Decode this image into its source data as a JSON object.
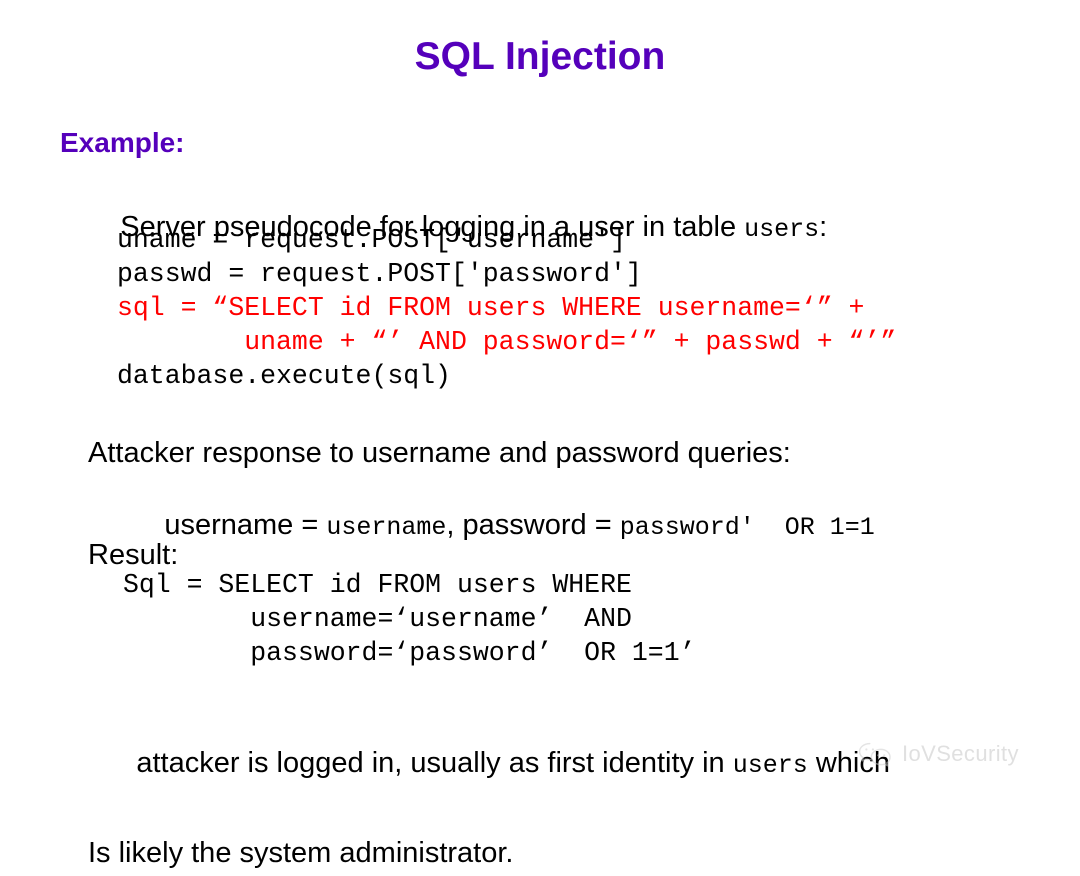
{
  "slide": {
    "title": "SQL Injection",
    "title_color": "#5500bb",
    "background_color": "#ffffff",
    "code_accent_color": "#ff0000"
  },
  "example": {
    "heading": "Example:",
    "lead_text_before": "Server pseudocode for logging in a user in table ",
    "lead_code": "users",
    "lead_text_after": ":"
  },
  "pseudocode": {
    "lines": [
      {
        "text": "uname = request.POST['username']",
        "color": "black"
      },
      {
        "text": "passwd = request.POST['password']",
        "color": "black"
      },
      {
        "text": "sql = “SELECT id FROM users WHERE username=‘” +",
        "color": "red"
      },
      {
        "text": "        uname + “’ AND password=‘” + passwd + “’”",
        "color": "red"
      },
      {
        "text": "database.execute(sql)",
        "color": "black"
      }
    ]
  },
  "attacker": {
    "intro": "Attacker response to username and password queries:",
    "field1_label": "username",
    "field1_equals": " = ",
    "field1_value": "username",
    "separator": ", ",
    "field2_label": "password",
    "field2_equals": " = ",
    "field2_value": "password'  OR 1=1"
  },
  "result": {
    "label": "Result:",
    "lines": [
      "Sql = SELECT id FROM users WHERE",
      "        username=‘username’  AND",
      "        password=‘password’  OR 1=1’"
    ]
  },
  "closing": {
    "line1_before": "attacker is logged in, usually as first identity in ",
    "line1_code": "users",
    "line1_after": " which",
    "line2": "Is likely the system administrator."
  },
  "watermark": {
    "icon": "wechat-icon",
    "label": "IoVSecurity",
    "color": "#c8c8c8"
  }
}
